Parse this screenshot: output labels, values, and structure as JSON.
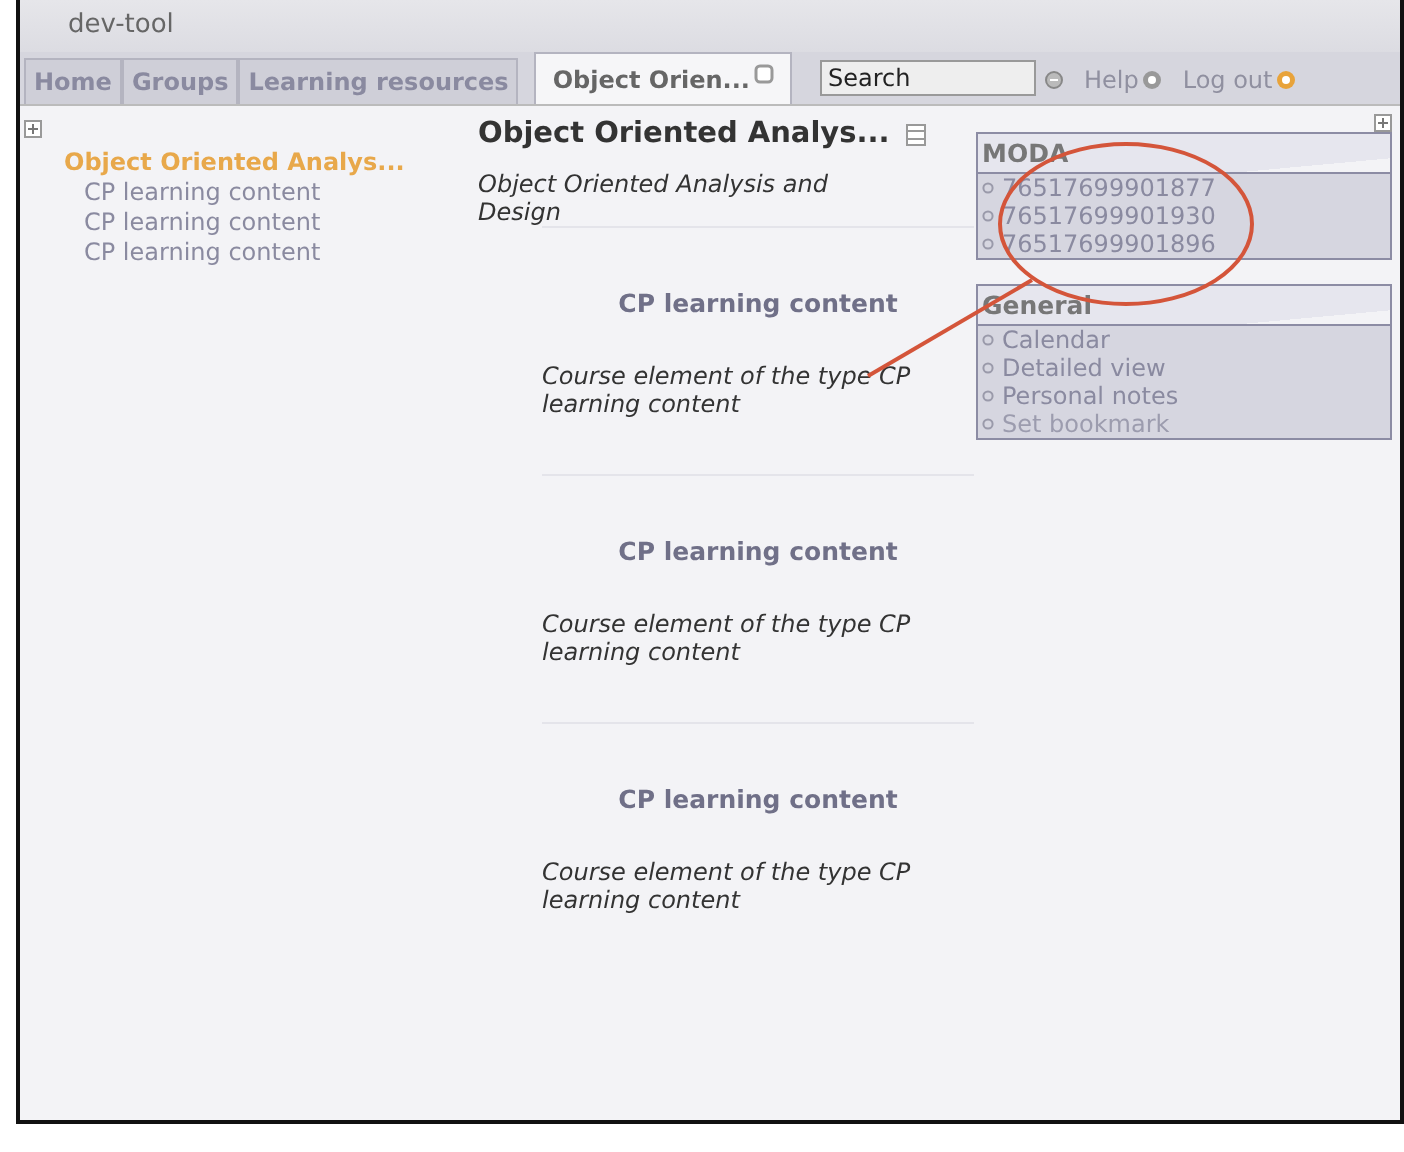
{
  "window": {
    "title": "dev-tool"
  },
  "tabs": [
    {
      "label": "Home",
      "selected": false,
      "closable": false
    },
    {
      "label": "Groups",
      "selected": false,
      "closable": false
    },
    {
      "label": "Learning resources",
      "selected": false,
      "closable": false
    },
    {
      "label": "Object Orien...",
      "selected": true,
      "closable": true
    }
  ],
  "search": {
    "placeholder": "Search"
  },
  "links": [
    "Help",
    "Log out"
  ],
  "tree": [
    {
      "label": "Object Oriented Analys...",
      "selected": true,
      "children": [
        {
          "label": "CP learning content",
          "selected": false
        },
        {
          "label": "CP learning content",
          "selected": false
        },
        {
          "label": "CP learning content",
          "selected": false
        }
      ]
    }
  ],
  "course": {
    "title": "Object Oriented Analys...",
    "description": "Object Oriented Analysis and Design",
    "elements": [
      {
        "title": "CP learning content",
        "description": "Course element of the type CP learning content"
      },
      {
        "title": "CP learning content",
        "description": "Course element of the type CP learning content"
      },
      {
        "title": "CP learning content",
        "description": "Course element of the type CP learning content"
      }
    ]
  },
  "portlets": [
    {
      "title": "MODA",
      "items": [
        {
          "label": "76517699901877",
          "disabled": false
        },
        {
          "label": "76517699901930",
          "disabled": false
        },
        {
          "label": "76517699901896",
          "disabled": false
        }
      ]
    },
    {
      "title": "General",
      "items": [
        {
          "label": "Calendar",
          "disabled": false
        },
        {
          "label": "Detailed view",
          "disabled": false
        },
        {
          "label": "Personal notes",
          "disabled": false
        },
        {
          "label": "Set bookmark",
          "disabled": true
        }
      ]
    }
  ]
}
